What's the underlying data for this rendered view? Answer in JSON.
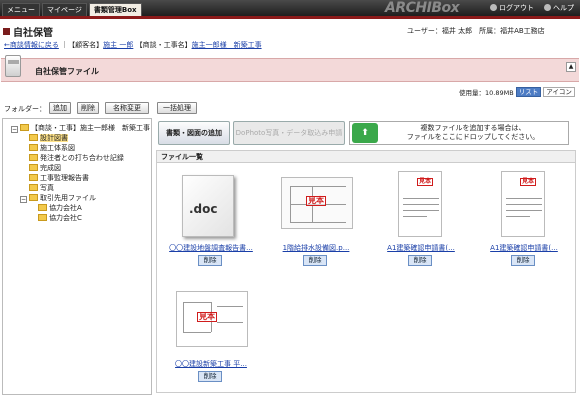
{
  "topnav": {
    "tabs": [
      "メニュー",
      "マイページ",
      "書類管理Box"
    ],
    "active": 2
  },
  "brand": "ARCHIBox",
  "toplinks": {
    "logout": "ログアウト",
    "help": "ヘルプ"
  },
  "page": {
    "title": "自社保管",
    "user_label": "ユーザー：福井 太郎",
    "office_label": "所属：福井AB工務店"
  },
  "breadcrumb": {
    "back": "←商談情報に戻る",
    "sep1": "｜【顧客名】",
    "customer": "施主 一郎",
    "sep2": "【商談・工事名】",
    "project": "施主一郎様　新築工事"
  },
  "section": {
    "title": "自社保管ファイル"
  },
  "usage": {
    "label": "使用量：10.89MB",
    "list": "リスト",
    "icon": "アイコン"
  },
  "folder_toolbar": {
    "label": "フォルダー：",
    "add": "追加",
    "delete": "削除",
    "rename": "名称変更",
    "batch": "一括処理"
  },
  "tree": {
    "root": "【商談・工事】施主一郎様　新築工事",
    "items": [
      "設計図書",
      "施工体系図",
      "発注者との打ち合わせ記録",
      "完成図",
      "工事監理報告書",
      "写真"
    ],
    "selected": "設計図書",
    "group": "取引先用ファイル",
    "subitems": [
      "協力会社A",
      "協力会社C"
    ]
  },
  "actions": {
    "add_docs": "書類・図面の追加",
    "dophoto": "DoPhoto写真・データ取込み申請",
    "drop_line1": "複数ファイルを追加する場合は、",
    "drop_line2": "ファイルをここにドロップしてください。",
    "drop_icon": "upload-arrow-icon"
  },
  "filelist": {
    "header": "ファイル一覧",
    "delete_label": "削除",
    "files": [
      {
        "name": "〇〇建設地盤調査報告書...",
        "thumb": "doc"
      },
      {
        "name": "1階給排水設備図.p...",
        "thumb": "plan"
      },
      {
        "name": "A1建築確認申請書(...",
        "thumb": "form"
      },
      {
        "name": "A1建築確認申請書(...",
        "thumb": "form"
      },
      {
        "name": "〇〇建設新築工事 平...",
        "thumb": "plan2"
      }
    ],
    "doc_label": ".doc",
    "stamp": "見本"
  }
}
